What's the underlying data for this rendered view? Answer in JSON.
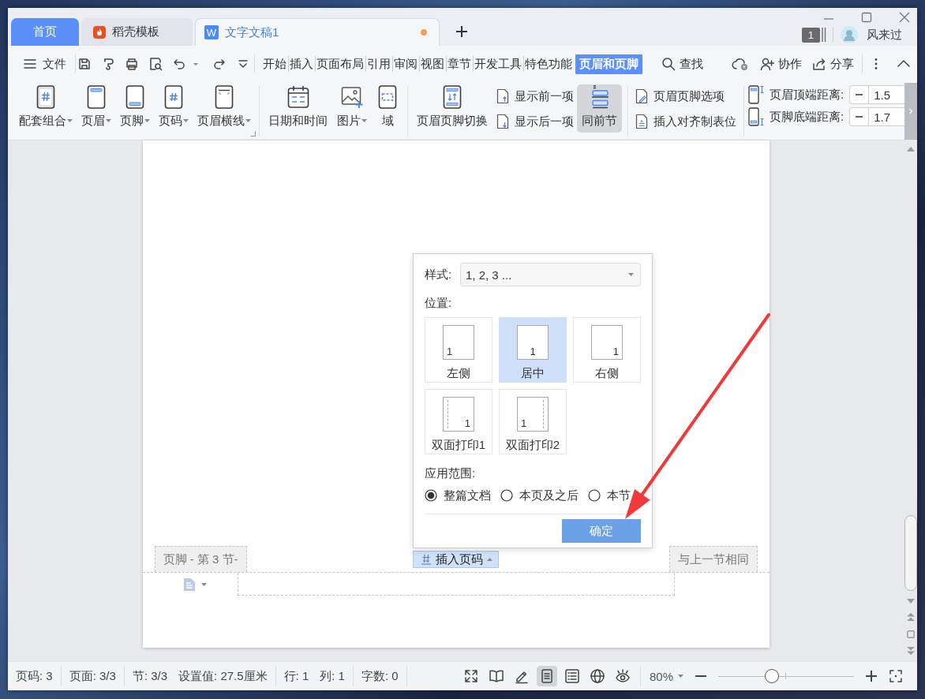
{
  "tabs": [
    {
      "label": "首页",
      "kind": "home",
      "selected": false,
      "modified": false
    },
    {
      "label": "稻壳模板",
      "kind": "template",
      "selected": false,
      "modified": false
    },
    {
      "label": "文字文稿1",
      "kind": "document",
      "logo": "W",
      "selected": true,
      "modified": true
    }
  ],
  "account": {
    "count": "1",
    "user": "风来过"
  },
  "menu": {
    "file": "文件",
    "tabs": [
      {
        "label": "开始",
        "selected": false
      },
      {
        "label": "插入",
        "selected": false
      },
      {
        "label": "页面布局",
        "selected": false
      },
      {
        "label": "引用",
        "selected": false
      },
      {
        "label": "审阅",
        "selected": false
      },
      {
        "label": "视图",
        "selected": false
      },
      {
        "label": "章节",
        "selected": false
      },
      {
        "label": "开发工具",
        "selected": false
      },
      {
        "label": "特色功能",
        "selected": false
      },
      {
        "label": "页眉和页脚",
        "selected": true
      }
    ],
    "search": "查找",
    "actions": [
      "协作",
      "分享"
    ]
  },
  "ribbon": {
    "groups": [
      {
        "launcher": true,
        "items": [
          {
            "kind": "large",
            "label": "配套组合",
            "dropdown": true,
            "pressed": false
          },
          {
            "kind": "large",
            "label": "页眉",
            "dropdown": true,
            "pressed": false
          },
          {
            "kind": "large",
            "label": "页脚",
            "dropdown": true,
            "pressed": false
          },
          {
            "kind": "large",
            "label": "页码",
            "dropdown": true,
            "pressed": false
          },
          {
            "kind": "large",
            "label": "页眉横线",
            "dropdown": true,
            "pressed": false
          }
        ]
      },
      {
        "launcher": false,
        "items": [
          {
            "kind": "large",
            "label": "日期和时间",
            "dropdown": false,
            "pressed": false
          },
          {
            "kind": "large",
            "label": "图片",
            "dropdown": true,
            "pressed": false
          },
          {
            "kind": "large",
            "label": "域",
            "dropdown": false,
            "pressed": false
          }
        ]
      },
      {
        "launcher": false,
        "items": [
          {
            "kind": "large",
            "label": "页眉页脚切换",
            "dropdown": false,
            "pressed": false
          },
          {
            "kind": "stack",
            "buttons": [
              "显示前一项",
              "显示后一项"
            ]
          },
          {
            "kind": "large",
            "label": "同前节",
            "dropdown": false,
            "pressed": true
          }
        ]
      },
      {
        "launcher": false,
        "items": [
          {
            "kind": "stack",
            "buttons": [
              "页眉页脚选项",
              "插入对齐制表位"
            ]
          }
        ]
      },
      {
        "launcher": false,
        "items": [
          {
            "kind": "spinners",
            "fields": [
              {
                "label": "页眉顶端距离:",
                "value": "1.5"
              },
              {
                "label": "页脚底端距离:",
                "value": "1.7"
              }
            ]
          }
        ]
      }
    ]
  },
  "document": {
    "footer_tag": "页脚 - 第 3 节-",
    "insert_button": "插入页码",
    "same_as_previous": "与上一节相同"
  },
  "page_number_popup": {
    "style_label": "样式:",
    "style_value": "1, 2, 3 ...",
    "position_label": "位置:",
    "positions": [
      {
        "label": "左侧",
        "kind": "left",
        "number": "1",
        "selected": false
      },
      {
        "label": "居中",
        "kind": "center",
        "number": "1",
        "selected": true
      },
      {
        "label": "右侧",
        "kind": "right",
        "number": "1",
        "selected": false
      },
      {
        "label": "双面打印1",
        "kind": "duplex-odd",
        "number": "1",
        "selected": false
      },
      {
        "label": "双面打印2",
        "kind": "duplex-even",
        "number": "1",
        "selected": false
      }
    ],
    "scope_label": "应用范围:",
    "scopes": [
      {
        "label": "整篇文档",
        "selected": true
      },
      {
        "label": "本页及之后",
        "selected": false
      },
      {
        "label": "本节",
        "selected": false
      }
    ],
    "confirm": "确定"
  },
  "status_bar": {
    "groups": [
      [
        "页码: 3"
      ],
      [
        "页面: 3/3"
      ],
      [
        "节: 3/3",
        "设置值: 27.5厘米"
      ],
      [
        "行: 1",
        "列: 1"
      ],
      [
        "字数: 0"
      ]
    ],
    "view_modes": [
      {
        "selected": false
      },
      {
        "selected": false
      },
      {
        "selected": false
      },
      {
        "selected": true
      },
      {
        "selected": false
      },
      {
        "selected": false
      },
      {
        "selected": false
      }
    ],
    "zoom": {
      "value": "80%",
      "level": 0.38
    }
  }
}
